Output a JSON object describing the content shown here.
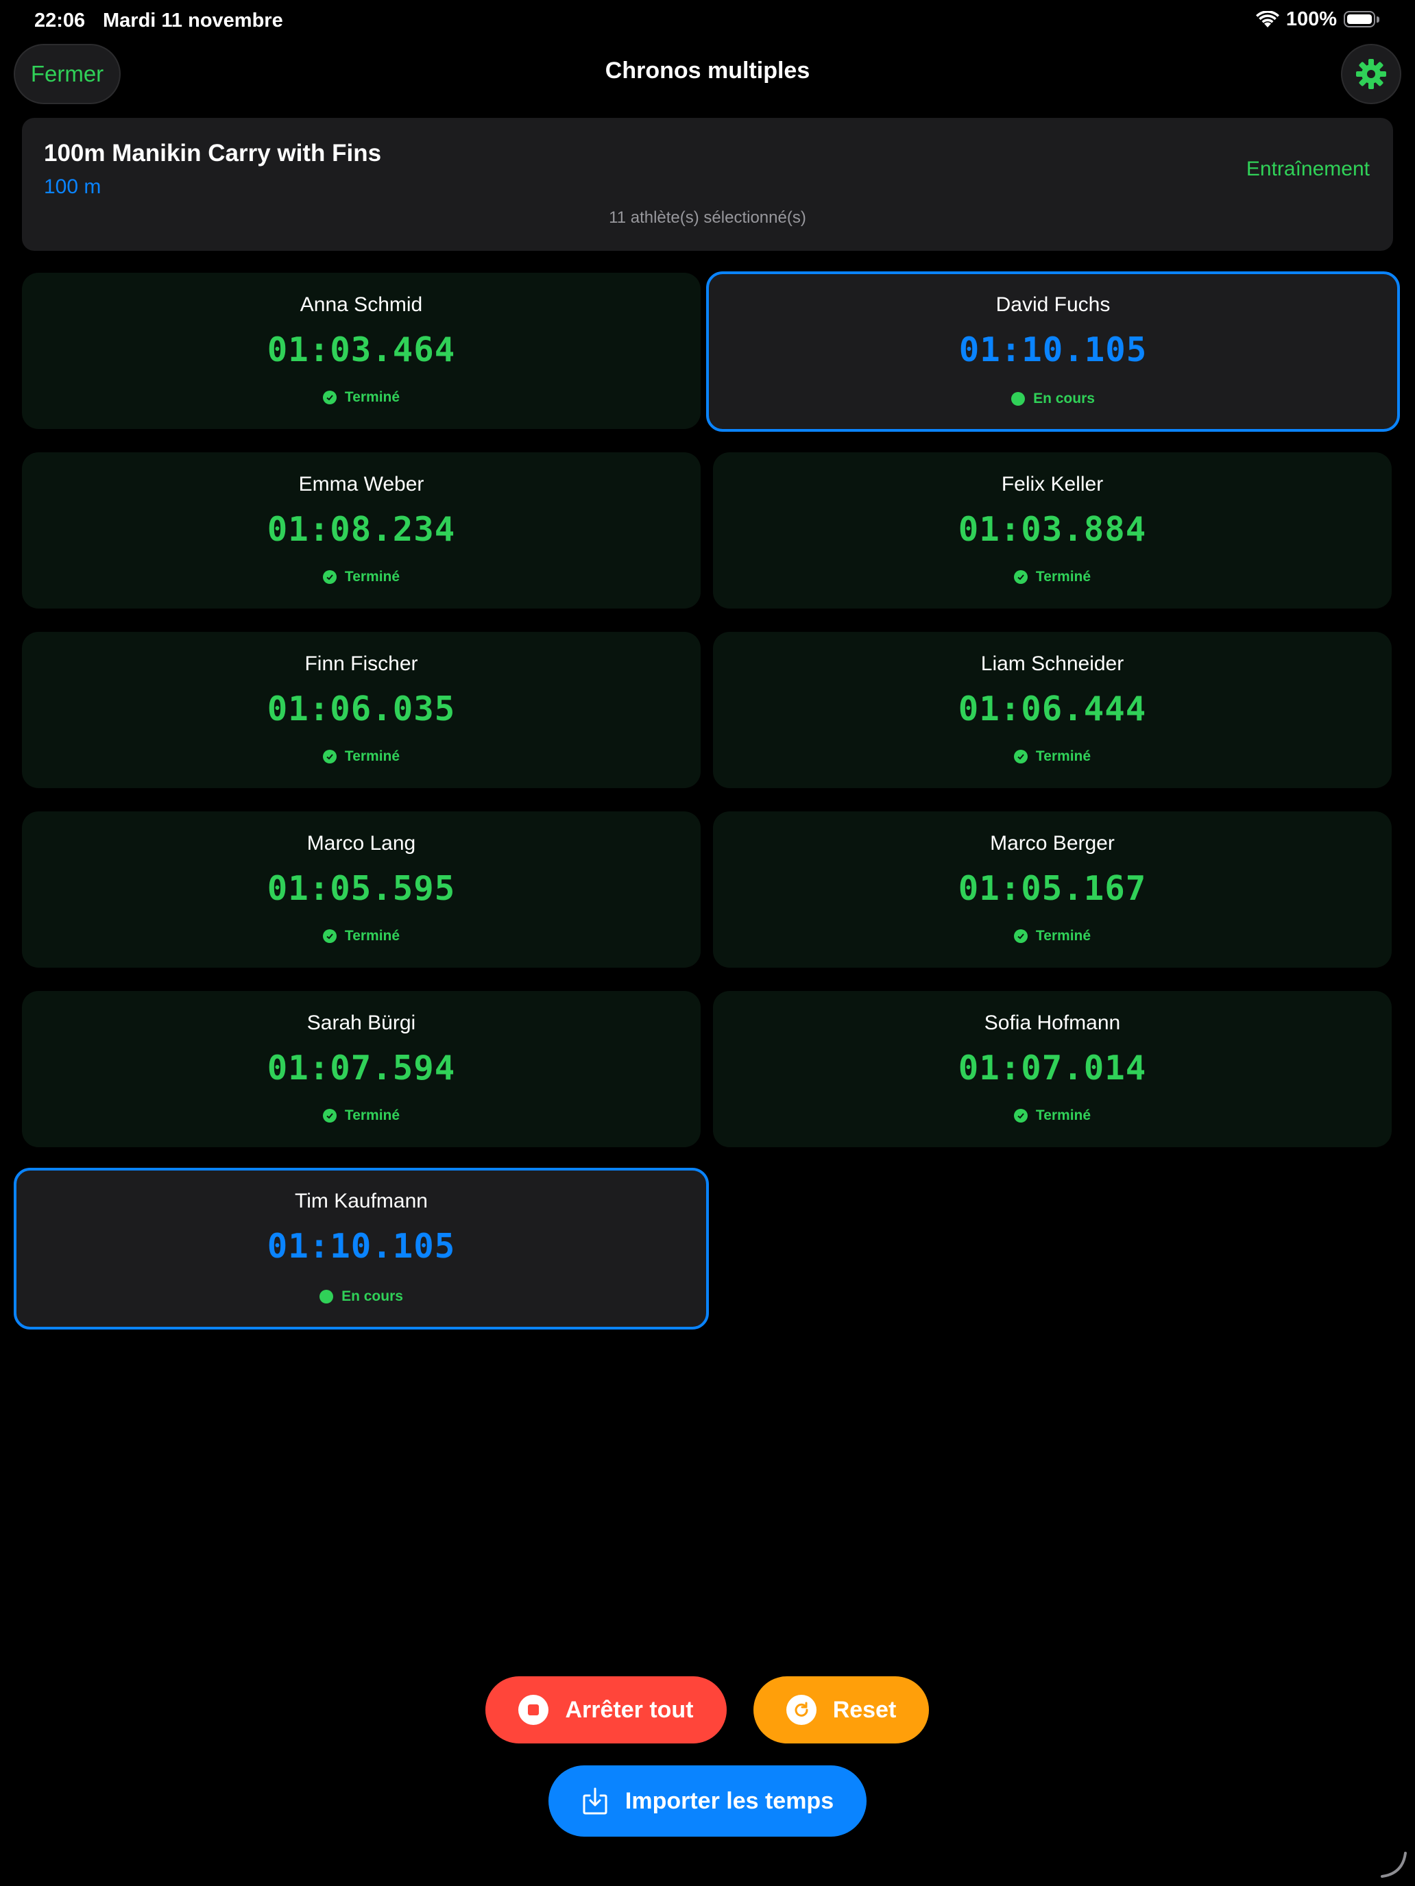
{
  "status_bar": {
    "time": "22:06",
    "date": "Mardi 11 novembre",
    "battery": "100%"
  },
  "nav": {
    "close_label": "Fermer",
    "title": "Chronos multiples",
    "settings_icon": "gear-icon"
  },
  "event": {
    "title": "100m Manikin Carry with Fins",
    "distance": "100 m",
    "mode": "Entraînement",
    "athletes_selected": "11 athlète(s) sélectionné(s)"
  },
  "timers": [
    {
      "name": "Anna Schmid",
      "time": "01:03.464",
      "status": "Terminé",
      "running": false
    },
    {
      "name": "David Fuchs",
      "time": "01:10.105",
      "status": "En cours",
      "running": true
    },
    {
      "name": "Emma Weber",
      "time": "01:08.234",
      "status": "Terminé",
      "running": false
    },
    {
      "name": "Felix Keller",
      "time": "01:03.884",
      "status": "Terminé",
      "running": false
    },
    {
      "name": "Finn Fischer",
      "time": "01:06.035",
      "status": "Terminé",
      "running": false
    },
    {
      "name": "Liam Schneider",
      "time": "01:06.444",
      "status": "Terminé",
      "running": false
    },
    {
      "name": "Marco Lang",
      "time": "01:05.595",
      "status": "Terminé",
      "running": false
    },
    {
      "name": "Marco Berger",
      "time": "01:05.167",
      "status": "Terminé",
      "running": false
    },
    {
      "name": "Sarah Bürgi",
      "time": "01:07.594",
      "status": "Terminé",
      "running": false
    },
    {
      "name": "Sofia Hofmann",
      "time": "01:07.014",
      "status": "Terminé",
      "running": false
    },
    {
      "name": "Tim Kaufmann",
      "time": "01:10.105",
      "status": "En cours",
      "running": true
    }
  ],
  "actions": {
    "stop_all": "Arrêter tout",
    "reset": "Reset",
    "import": "Importer les temps"
  },
  "colors": {
    "accent_green": "#30d158",
    "accent_blue": "#0a84ff",
    "stop_red": "#ff453a",
    "reset_orange": "#ff9f0a"
  }
}
